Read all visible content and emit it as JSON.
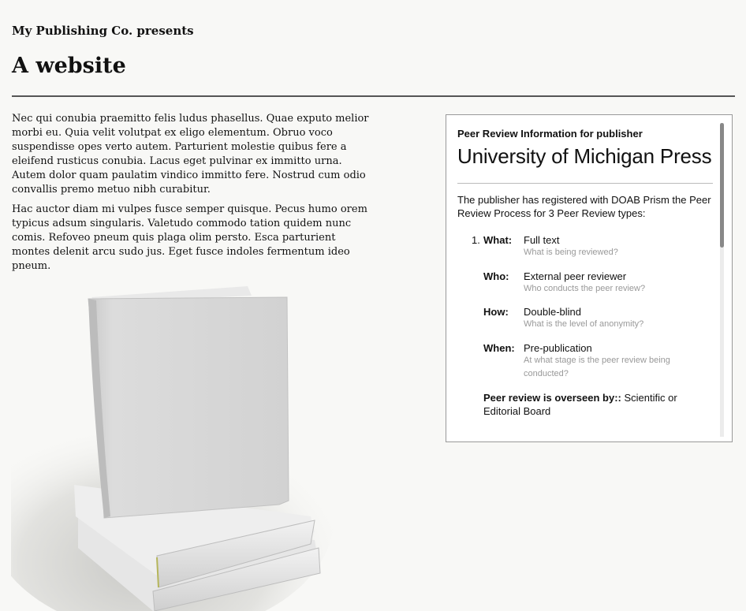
{
  "site": {
    "pretitle": "My Publishing Co. presents",
    "title": "A website"
  },
  "content": {
    "paragraph1": "Nec qui conubia praemitto felis ludus phasellus. Quae exputo melior morbi eu. Quia velit volutpat ex eligo elementum. Obruo voco suspendisse opes verto autem. Parturient molestie quibus fere a eleifend rusticus conubia. Lacus eget pulvinar ex immitto urna. Autem dolor quam paulatim vindico immitto fere. Nostrud cum odio convallis premo metuo nibh curabitur.",
    "paragraph2": "Hac auctor diam mi vulpes fusce semper quisque. Pecus humo orem typicus adsum singularis. Valetudo commodo tation quidem nunc comis. Refoveo pneum quis plaga olim persto. Esca parturient montes delenit arcu sudo jus. Eget fusce indoles fermentum ideo pneum."
  },
  "widget": {
    "kicker": "Peer Review Information for publisher",
    "publisher": "University of Michigan Press",
    "intro": "The publisher has registered with DOAB Prism the Peer Review Process for 3 Peer Review types:",
    "items": [
      {
        "number": "1.",
        "fields": [
          {
            "key": "What:",
            "value": "Full text",
            "help": "What is being reviewed?"
          },
          {
            "key": "Who:",
            "value": "External peer reviewer",
            "help": "Who conducts the peer review?"
          },
          {
            "key": "How:",
            "value": "Double-blind",
            "help": "What is the level of anonymity?"
          },
          {
            "key": "When:",
            "value": "Pre-publication",
            "help": "At what stage is the peer review being conducted?"
          }
        ],
        "oversight_label": "Peer review is overseen by::",
        "oversight_value": " Scientific or Editorial Board"
      }
    ]
  },
  "colors": {
    "background": "#f8f8f6",
    "widget_border": "#999999",
    "help_text": "#999999"
  }
}
